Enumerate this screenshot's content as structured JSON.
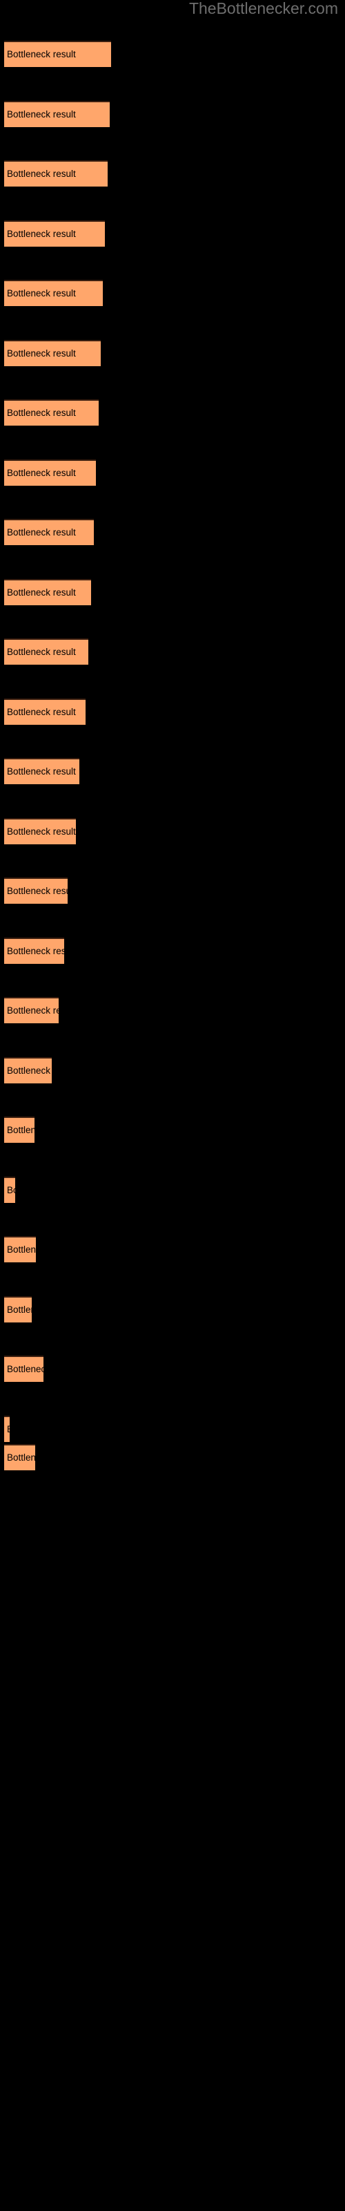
{
  "watermark": "TheBottlenecker.com",
  "colors": {
    "background": "#000000",
    "bar_fill": "#ffa66b",
    "bar_border_top": "#3b1f10",
    "bar_text": "#000000",
    "watermark_text": "#6e6e6e"
  },
  "chart_data": {
    "type": "bar",
    "orientation": "horizontal",
    "title": "",
    "subtitle": "",
    "xlabel": "",
    "ylabel": "",
    "grid": false,
    "legend": null,
    "annotations": [
      "TheBottlenecker.com"
    ],
    "axis_visible": false,
    "tick_labels": [],
    "bar_label_text": "Bottleneck result",
    "categories": [
      "Bottleneck result",
      "Bottleneck result",
      "Bottleneck result",
      "Bottleneck result",
      "Bottleneck result",
      "Bottleneck result",
      "Bottleneck result",
      "Bottleneck result",
      "Bottleneck result",
      "Bottleneck result",
      "Bottleneck result",
      "Bottleneck result",
      "Bottleneck result",
      "Bottleneck result",
      "Bottleneck result",
      "Bottleneck result",
      "Bottleneck result",
      "Bottleneck result",
      "Bottleneck result",
      "Bottleneck result",
      "Bottleneck result",
      "Bottleneck result",
      "Bottleneck result",
      "Bottleneck result"
    ],
    "values": [
      155,
      153,
      150,
      146,
      143,
      140,
      137,
      133,
      130,
      126,
      122,
      118,
      109,
      104,
      92,
      87,
      79,
      69,
      44,
      16,
      46,
      40,
      57,
      8
    ],
    "xlim": [
      0,
      155
    ],
    "bars": [
      {
        "index": 1,
        "label": "Bottleneck result",
        "value": 155,
        "top": 59,
        "width": 155
      },
      {
        "index": 2,
        "label": "Bottleneck result",
        "value": 153,
        "top": 146,
        "width": 153
      },
      {
        "index": 3,
        "label": "Bottleneck result",
        "value": 150,
        "top": 232,
        "width": 150
      },
      {
        "index": 4,
        "label": "Bottleneck result",
        "value": 146,
        "top": 319,
        "width": 146
      },
      {
        "index": 5,
        "label": "Bottleneck result",
        "value": 143,
        "top": 405,
        "width": 143
      },
      {
        "index": 6,
        "label": "Bottleneck result",
        "value": 140,
        "top": 492,
        "width": 140
      },
      {
        "index": 7,
        "label": "Bottleneck result",
        "value": 137,
        "top": 578,
        "width": 137
      },
      {
        "index": 8,
        "label": "Bottleneck result",
        "value": 133,
        "top": 665,
        "width": 133
      },
      {
        "index": 9,
        "label": "Bottleneck result",
        "value": 130,
        "top": 751,
        "width": 130
      },
      {
        "index": 10,
        "label": "Bottleneck result",
        "value": 126,
        "top": 838,
        "width": 126
      },
      {
        "index": 11,
        "label": "Bottleneck result",
        "value": 122,
        "top": 924,
        "width": 122
      },
      {
        "index": 12,
        "label": "Bottleneck result",
        "value": 118,
        "top": 1011,
        "width": 118
      },
      {
        "index": 13,
        "label": "Bottleneck result",
        "value": 109,
        "top": 1097,
        "width": 109
      },
      {
        "index": 14,
        "label": "Bottleneck result",
        "value": 104,
        "top": 1184,
        "width": 104
      },
      {
        "index": 15,
        "label": "Bottleneck result",
        "value": 92,
        "top": 1270,
        "width": 92
      },
      {
        "index": 16,
        "label": "Bottleneck result",
        "value": 87,
        "top": 1357,
        "width": 87
      },
      {
        "index": 17,
        "label": "Bottleneck result",
        "value": 79,
        "top": 1443,
        "width": 79
      },
      {
        "index": 18,
        "label": "Bottleneck result",
        "value": 69,
        "top": 1530,
        "width": 69
      },
      {
        "index": 19,
        "label": "Bottleneck result",
        "value": 44,
        "top": 1616,
        "width": 44
      },
      {
        "index": 20,
        "label": "Bottleneck result",
        "value": 16,
        "top": 1703,
        "width": 16
      },
      {
        "index": 21,
        "label": "Bottleneck result",
        "value": 46,
        "top": 1789,
        "width": 46
      },
      {
        "index": 22,
        "label": "Bottleneck result",
        "value": 40,
        "top": 1876,
        "width": 40
      },
      {
        "index": 23,
        "label": "Bottleneck result",
        "value": 57,
        "top": 1962,
        "width": 57
      },
      {
        "index": 24,
        "label": "Bottleneck result",
        "value": 8,
        "top": 2049,
        "width": 8
      },
      {
        "index": 25,
        "label": "Bottleneck result",
        "value": 45,
        "top": 2090,
        "width": 45
      }
    ]
  }
}
